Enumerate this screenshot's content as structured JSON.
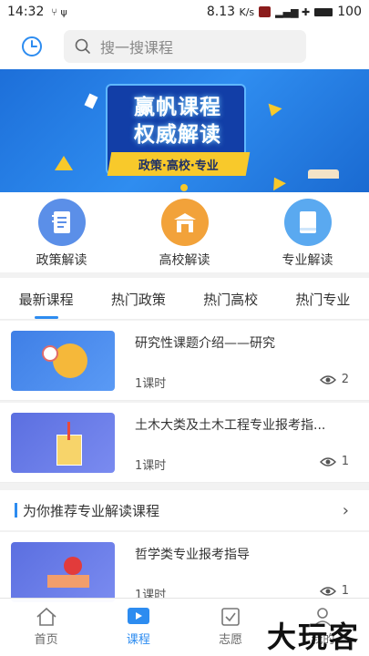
{
  "status_bar": {
    "time": "14:32",
    "speed": "8.13",
    "speed_unit": "K/s",
    "battery": "100"
  },
  "header": {
    "search_placeholder": "搜一搜课程"
  },
  "banner": {
    "line1": "赢帆课程",
    "line2": "权威解读",
    "ribbon": "政策·高校·专业"
  },
  "quick_links": [
    {
      "label": "政策解读",
      "icon": "notebook-icon",
      "color": "#5b8fe8"
    },
    {
      "label": "高校解读",
      "icon": "school-gate-icon",
      "color": "#f2a23a"
    },
    {
      "label": "专业解读",
      "icon": "book-icon",
      "color": "#5aa9f0"
    }
  ],
  "tabs": [
    "最新课程",
    "热门政策",
    "热门高校",
    "热门专业"
  ],
  "courses": [
    {
      "title": "研究性课题介绍——研究",
      "hours": "1课时",
      "views": "2"
    },
    {
      "title": "土木大类及土木工程专业报考指...",
      "hours": "1课时",
      "views": "1"
    },
    {
      "title": "哲学类专业报考指导",
      "hours": "1课时",
      "views": "1"
    }
  ],
  "section": {
    "title": "为你推荐专业解读课程"
  },
  "bottom_nav": [
    "首页",
    "课程",
    "志愿",
    "我的"
  ],
  "watermark": "大玩客",
  "colors": {
    "accent": "#2d8cf0",
    "banner_blue": "#1d6fd9",
    "ribbon_yellow": "#f8c92b"
  }
}
